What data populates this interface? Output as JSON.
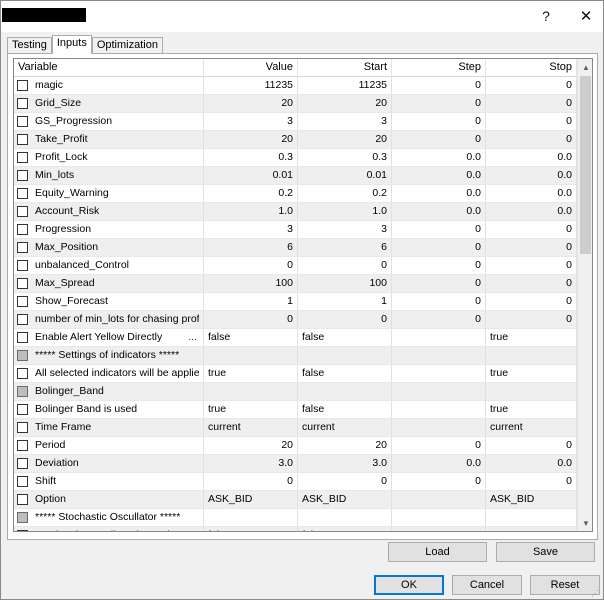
{
  "titlebar": {
    "help_label": "?",
    "close_label": "✕"
  },
  "tabs": [
    {
      "label": "Testing",
      "active": false
    },
    {
      "label": "Inputs",
      "active": true
    },
    {
      "label": "Optimization",
      "active": false
    }
  ],
  "grid": {
    "columns": [
      "Variable",
      "Value",
      "Start",
      "Step",
      "Stop"
    ],
    "rows": [
      {
        "variable": "magic",
        "value": "11235",
        "start": "11235",
        "step": "0",
        "stop": "0",
        "kind": "num"
      },
      {
        "variable": "Grid_Size",
        "value": "20",
        "start": "20",
        "step": "0",
        "stop": "0",
        "kind": "num"
      },
      {
        "variable": "GS_Progression",
        "value": "3",
        "start": "3",
        "step": "0",
        "stop": "0",
        "kind": "num"
      },
      {
        "variable": "Take_Profit",
        "value": "20",
        "start": "20",
        "step": "0",
        "stop": "0",
        "kind": "num"
      },
      {
        "variable": "Profit_Lock",
        "value": "0.3",
        "start": "0.3",
        "step": "0.0",
        "stop": "0.0",
        "kind": "num"
      },
      {
        "variable": "Min_lots",
        "value": "0.01",
        "start": "0.01",
        "step": "0.0",
        "stop": "0.0",
        "kind": "num"
      },
      {
        "variable": "Equity_Warning",
        "value": "0.2",
        "start": "0.2",
        "step": "0.0",
        "stop": "0.0",
        "kind": "num"
      },
      {
        "variable": "Account_Risk",
        "value": "1.0",
        "start": "1.0",
        "step": "0.0",
        "stop": "0.0",
        "kind": "num"
      },
      {
        "variable": "Progression",
        "value": "3",
        "start": "3",
        "step": "0",
        "stop": "0",
        "kind": "num"
      },
      {
        "variable": "Max_Position",
        "value": "6",
        "start": "6",
        "step": "0",
        "stop": "0",
        "kind": "num"
      },
      {
        "variable": "unbalanced_Control",
        "value": "0",
        "start": "0",
        "step": "0",
        "stop": "0",
        "kind": "num"
      },
      {
        "variable": "Max_Spread",
        "value": "100",
        "start": "100",
        "step": "0",
        "stop": "0",
        "kind": "num"
      },
      {
        "variable": "Show_Forecast",
        "value": "1",
        "start": "1",
        "step": "0",
        "stop": "0",
        "kind": "num"
      },
      {
        "variable": "number of min_lots for chasing profit",
        "value": "0",
        "start": "0",
        "step": "0",
        "stop": "0",
        "kind": "num"
      },
      {
        "variable": "Enable Alert Yellow Directly",
        "dots": "...",
        "value": "false",
        "start": "false",
        "step": "",
        "stop": "true",
        "kind": "text"
      },
      {
        "variable": "*****   Settings of indicators   *****",
        "value": "",
        "start": "",
        "step": "",
        "stop": "",
        "kind": "section"
      },
      {
        "variable": "All selected indicators will be applie...",
        "value": "true",
        "start": "false",
        "step": "",
        "stop": "true",
        "kind": "text"
      },
      {
        "variable": "Bolinger_Band",
        "value": "",
        "start": "",
        "step": "",
        "stop": "",
        "kind": "section"
      },
      {
        "variable": "Bolinger Band is used",
        "value": "true",
        "start": "false",
        "step": "",
        "stop": "true",
        "kind": "text"
      },
      {
        "variable": "Time Frame",
        "value": "current",
        "start": "current",
        "step": "",
        "stop": "current",
        "kind": "text"
      },
      {
        "variable": "Period",
        "value": "20",
        "start": "20",
        "step": "0",
        "stop": "0",
        "kind": "num"
      },
      {
        "variable": "Deviation",
        "value": "3.0",
        "start": "3.0",
        "step": "0.0",
        "stop": "0.0",
        "kind": "num"
      },
      {
        "variable": "Shift",
        "value": "0",
        "start": "0",
        "step": "0",
        "stop": "0",
        "kind": "num"
      },
      {
        "variable": "Option",
        "value": "ASK_BID",
        "start": "ASK_BID",
        "step": "",
        "stop": "ASK_BID",
        "kind": "text"
      },
      {
        "variable": "*****    Stochastic Oscullator    *****",
        "value": "",
        "start": "",
        "step": "",
        "stop": "",
        "kind": "section"
      },
      {
        "variable": "Stochastic Oscullator is used",
        "value": "false",
        "start": "false",
        "step": "",
        "stop": "true",
        "kind": "text"
      }
    ]
  },
  "scroll": {
    "position": 0.0
  },
  "buttons": {
    "load": "Load",
    "save": "Save",
    "ok": "OK",
    "cancel": "Cancel",
    "reset": "Reset"
  }
}
